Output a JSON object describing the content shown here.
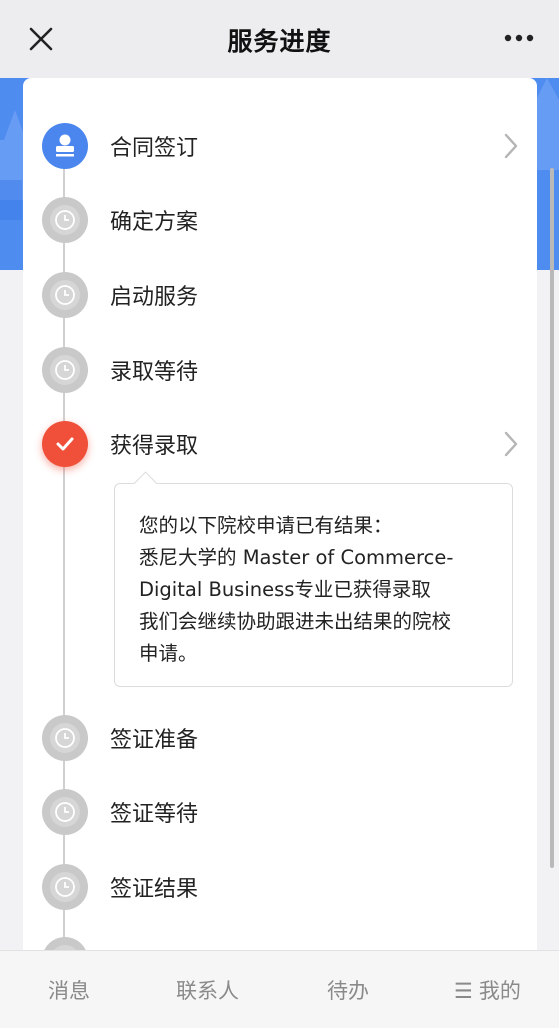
{
  "header": {
    "title": "服务进度",
    "close_icon": "close-icon",
    "more_icon": "more-icon"
  },
  "colors": {
    "accent_blue": "#4a86ee",
    "accent_red": "#f0503a",
    "pending_gray": "#c9c9c9"
  },
  "steps": [
    {
      "label": "合同签订",
      "state": "completed",
      "icon": "stamp-icon",
      "has_chevron": true
    },
    {
      "label": "确定方案",
      "state": "pending",
      "icon": "clock-icon",
      "has_chevron": false
    },
    {
      "label": "启动服务",
      "state": "pending",
      "icon": "clock-icon",
      "has_chevron": false
    },
    {
      "label": "录取等待",
      "state": "pending",
      "icon": "clock-icon",
      "has_chevron": false
    },
    {
      "label": "获得录取",
      "state": "current",
      "icon": "check-icon",
      "has_chevron": true
    },
    {
      "label": "签证准备",
      "state": "pending",
      "icon": "clock-icon",
      "has_chevron": false
    },
    {
      "label": "签证等待",
      "state": "pending",
      "icon": "clock-icon",
      "has_chevron": false
    },
    {
      "label": "签证结果",
      "state": "pending",
      "icon": "clock-icon",
      "has_chevron": false
    }
  ],
  "result_message": {
    "lines": [
      "您的以下院校申请已有结果：",
      "悉尼大学的 Master of Commerce-",
      "Digital Business专业已获得录取",
      "我们会继续协助跟进未出结果的院校",
      "申请。"
    ]
  },
  "bottom_nav": {
    "items": [
      {
        "label": "消息"
      },
      {
        "label": "联系人"
      },
      {
        "label": "待办"
      },
      {
        "label": "我的",
        "icon": "menu-icon"
      }
    ]
  }
}
